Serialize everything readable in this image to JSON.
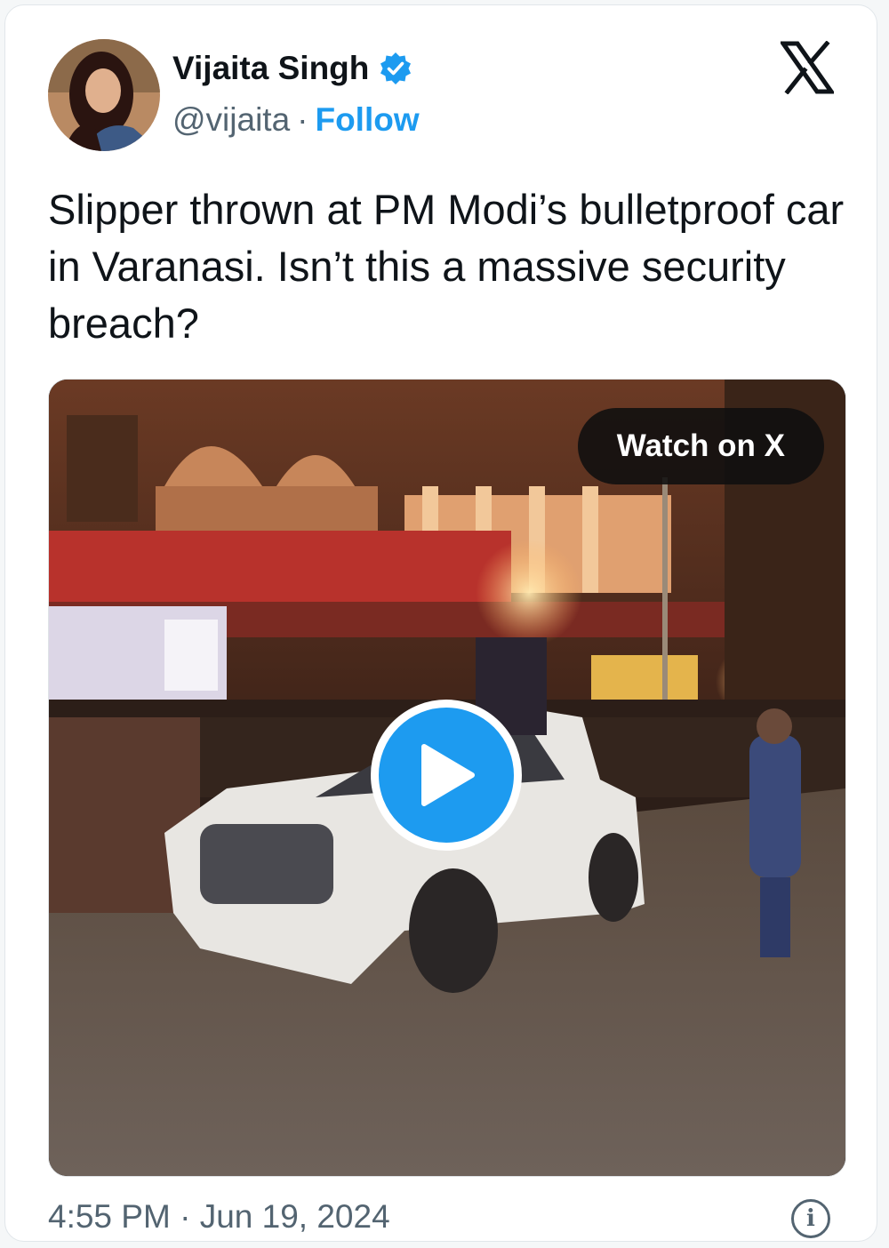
{
  "author": {
    "name": "Vijaita Singh",
    "handle": "@vijaita",
    "separator": "·",
    "follow_label": "Follow",
    "verified": true
  },
  "tweet": {
    "text": "Slipper thrown at PM Modi’s bulletproof car in Varanasi. Isn’t this a massive security breach?"
  },
  "media": {
    "watch_label": "Watch on X",
    "type": "video"
  },
  "footer": {
    "time": "4:55 PM",
    "separator": "·",
    "date": "Jun 19, 2024"
  },
  "icons": {
    "brand": "x-logo-icon",
    "verified": "verified-badge-icon",
    "play": "play-icon",
    "info": "info-icon"
  },
  "colors": {
    "accent": "#1d9bf0",
    "text_primary": "#0f1419",
    "text_secondary": "#536471"
  }
}
